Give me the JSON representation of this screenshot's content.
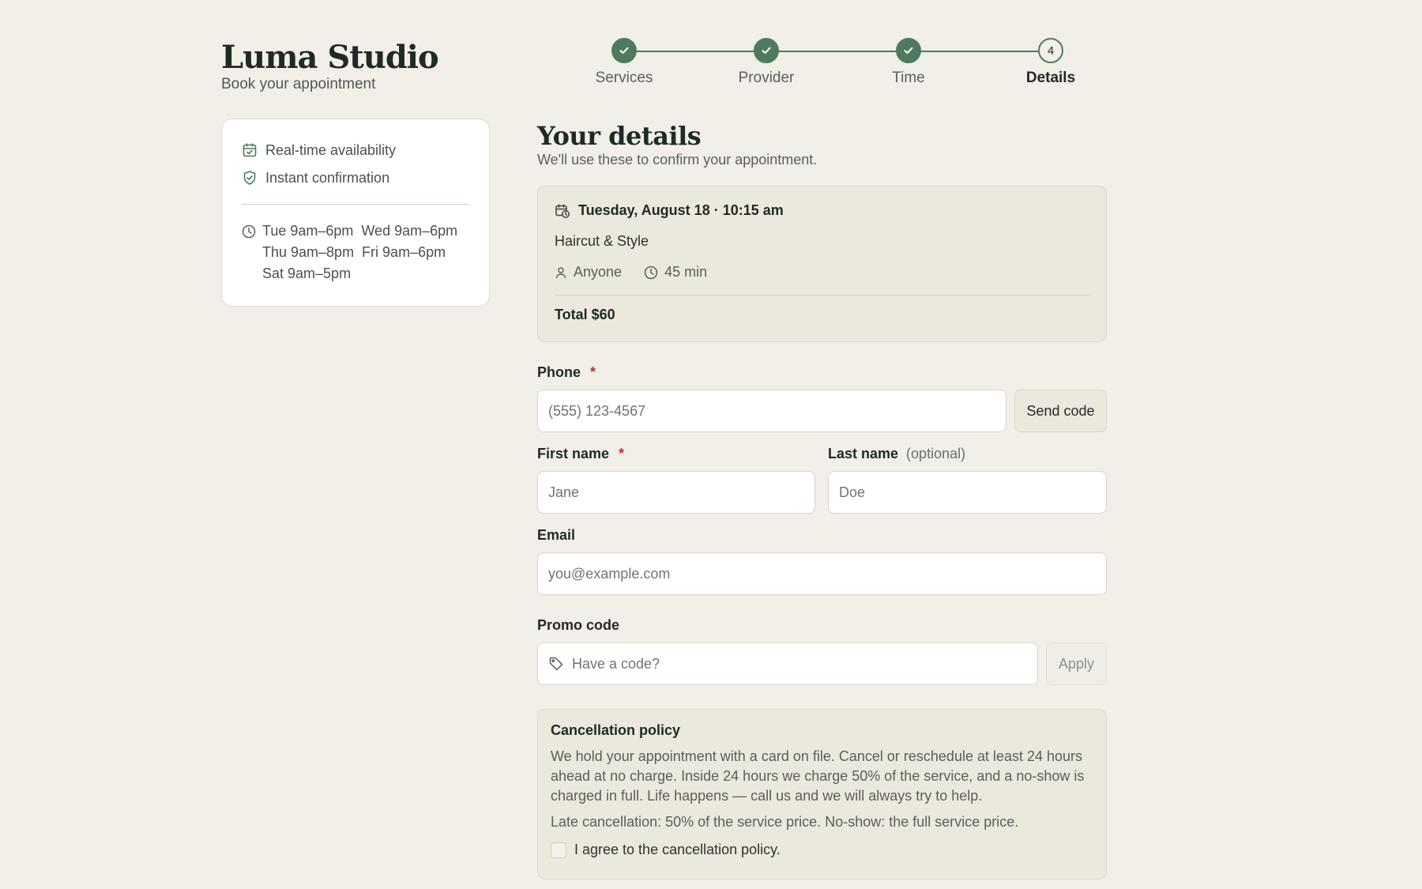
{
  "brand": {
    "title": "Luma Studio",
    "subtitle": "Book your appointment"
  },
  "stepper": {
    "steps": [
      {
        "label": "Services",
        "state": "done"
      },
      {
        "label": "Provider",
        "state": "done"
      },
      {
        "label": "Time",
        "state": "done"
      },
      {
        "label": "Details",
        "state": "current",
        "number": "4"
      }
    ]
  },
  "info": {
    "features": [
      "Real-time availability",
      "Instant confirmation"
    ],
    "hours": [
      "Tue 9am–6pm  Wed 9am–6pm",
      "Thu 9am–8pm  Fri 9am–6pm",
      "Sat 9am–5pm"
    ]
  },
  "page": {
    "title": "Your details",
    "subtitle": "We'll use these to confirm your appointment."
  },
  "summary": {
    "datetime": "Tuesday, August 18 · 10:15 am",
    "service": "Haircut & Style",
    "provider": "Anyone",
    "duration": "45 min",
    "total": "Total $60"
  },
  "form": {
    "phone": {
      "label": "Phone",
      "required_mark": "*",
      "placeholder": "(555) 123-4567",
      "button": "Send code"
    },
    "first_name": {
      "label": "First name",
      "required_mark": "*",
      "placeholder": "Jane"
    },
    "last_name": {
      "label": "Last name",
      "optional": "(optional)",
      "placeholder": "Doe"
    },
    "email": {
      "label": "Email",
      "placeholder": "you@example.com"
    },
    "promo": {
      "label": "Promo code",
      "placeholder": "Have a code?",
      "button": "Apply"
    }
  },
  "policy": {
    "title": "Cancellation policy",
    "text": "We hold your appointment with a card on file. Cancel or reschedule at least 24 hours ahead at no charge. Inside 24 hours we charge 50% of the service, and a no-show is charged in full. Life happens — call us and we will always try to help.",
    "note": "Late cancellation: 50% of the service price. No-show: the full service price.",
    "agree_label": "I agree to the cancellation policy.",
    "agree_checked": false
  },
  "colors": {
    "accent": "#4e7b5f",
    "background": "#f1efe7",
    "required": "#b03a32"
  }
}
